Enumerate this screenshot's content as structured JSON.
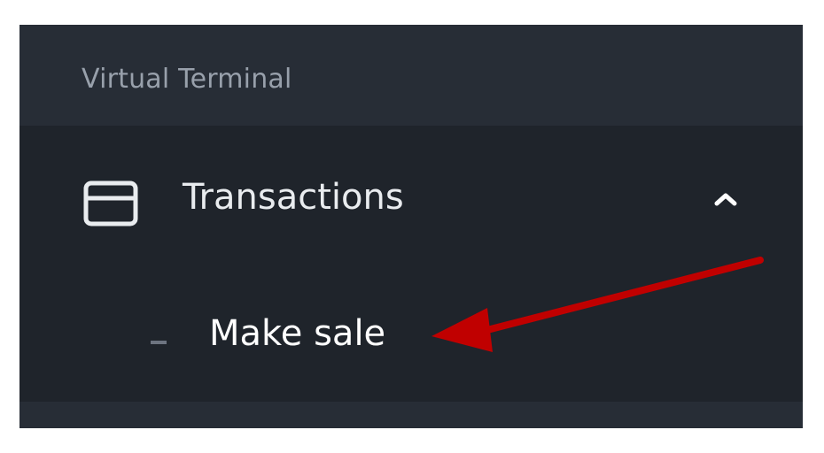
{
  "section": {
    "label": "Virtual Terminal"
  },
  "menu": {
    "item": {
      "label": "Transactions",
      "icon": "credit-card-icon",
      "expanded": true,
      "chevron_icon": "chevron-up-icon"
    },
    "submenu": [
      {
        "label": "Make sale"
      }
    ]
  },
  "annotation": {
    "arrow_color": "#c00000"
  },
  "colors": {
    "sidebar_bg": "#1f242b",
    "section_bg": "#272d36",
    "text_primary": "#e9ecef",
    "text_muted": "#98a0ab"
  }
}
